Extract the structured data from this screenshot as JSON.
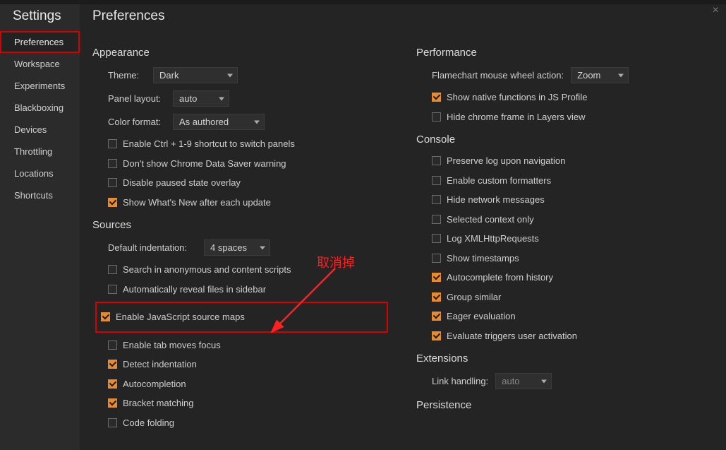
{
  "sidebar": {
    "title": "Settings",
    "items": [
      {
        "label": "Preferences",
        "selected": true
      },
      {
        "label": "Workspace"
      },
      {
        "label": "Experiments"
      },
      {
        "label": "Blackboxing"
      },
      {
        "label": "Devices"
      },
      {
        "label": "Throttling"
      },
      {
        "label": "Locations"
      },
      {
        "label": "Shortcuts"
      }
    ]
  },
  "page_title": "Preferences",
  "appearance": {
    "title": "Appearance",
    "theme_label": "Theme:",
    "theme_value": "Dark",
    "panel_layout_label": "Panel layout:",
    "panel_layout_value": "auto",
    "color_format_label": "Color format:",
    "color_format_value": "As authored",
    "checks": [
      {
        "label": "Enable Ctrl + 1-9 shortcut to switch panels",
        "checked": false
      },
      {
        "label": "Don't show Chrome Data Saver warning",
        "checked": false
      },
      {
        "label": "Disable paused state overlay",
        "checked": false
      },
      {
        "label": "Show What's New after each update",
        "checked": true
      }
    ]
  },
  "sources": {
    "title": "Sources",
    "default_indent_label": "Default indentation:",
    "default_indent_value": "4 spaces",
    "checks": [
      {
        "label": "Search in anonymous and content scripts",
        "checked": false
      },
      {
        "label": "Automatically reveal files in sidebar",
        "checked": false
      },
      {
        "label": "Enable JavaScript source maps",
        "checked": true,
        "highlight": true
      },
      {
        "label": "Enable tab moves focus",
        "checked": false
      },
      {
        "label": "Detect indentation",
        "checked": true
      },
      {
        "label": "Autocompletion",
        "checked": true
      },
      {
        "label": "Bracket matching",
        "checked": true
      },
      {
        "label": "Code folding",
        "checked": false
      }
    ]
  },
  "performance": {
    "title": "Performance",
    "flamechart_label": "Flamechart mouse wheel action:",
    "flamechart_value": "Zoom",
    "checks": [
      {
        "label": "Show native functions in JS Profile",
        "checked": true
      },
      {
        "label": "Hide chrome frame in Layers view",
        "checked": false
      }
    ]
  },
  "console": {
    "title": "Console",
    "checks": [
      {
        "label": "Preserve log upon navigation",
        "checked": false
      },
      {
        "label": "Enable custom formatters",
        "checked": false
      },
      {
        "label": "Hide network messages",
        "checked": false
      },
      {
        "label": "Selected context only",
        "checked": false
      },
      {
        "label": "Log XMLHttpRequests",
        "checked": false
      },
      {
        "label": "Show timestamps",
        "checked": false
      },
      {
        "label": "Autocomplete from history",
        "checked": true
      },
      {
        "label": "Group similar",
        "checked": true
      },
      {
        "label": "Eager evaluation",
        "checked": true
      },
      {
        "label": "Evaluate triggers user activation",
        "checked": true
      }
    ]
  },
  "extensions": {
    "title": "Extensions",
    "link_handling_label": "Link handling:",
    "link_handling_value": "auto"
  },
  "persistence": {
    "title": "Persistence"
  },
  "annotation": "取消掉"
}
